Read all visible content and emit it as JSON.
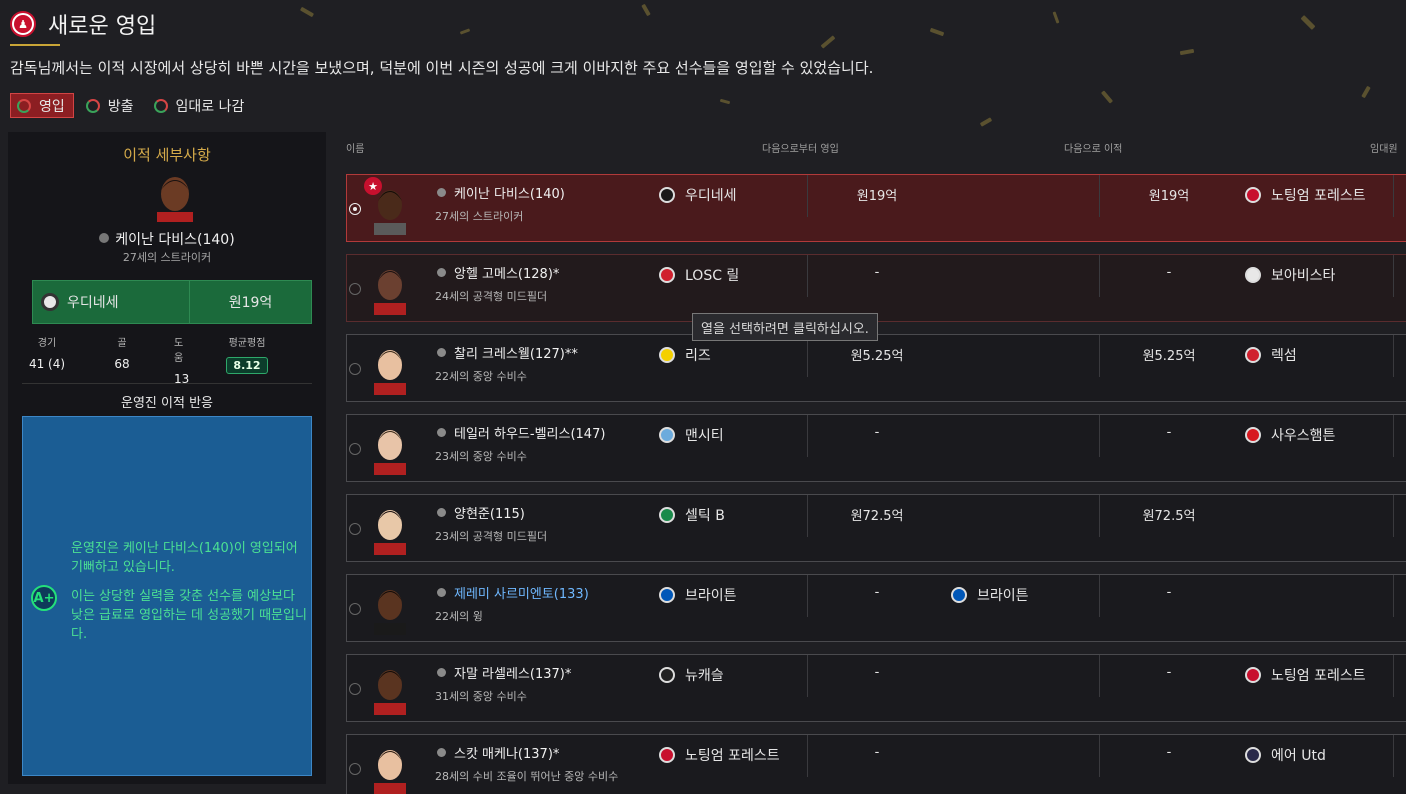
{
  "header": {
    "title": "새로운 영입",
    "subtitle": "감독님께서는 이적 시장에서 상당히 바쁜 시간을 보냈으며, 덕분에 이번 시즌의 성공에 크게 이바지한 주요 선수들을 영입할 수 있었습니다."
  },
  "tabs": [
    {
      "label": "영입",
      "active": true
    },
    {
      "label": "방출",
      "active": false
    },
    {
      "label": "임대로 나감",
      "active": false
    }
  ],
  "details": {
    "title": "이적 세부사항",
    "player_name": "케이난 다비스(140)",
    "player_desc": "27세의 스트라이커",
    "from_club": "우디네세",
    "fee": "원19억",
    "stats": [
      {
        "label": "경기",
        "value": "41 (4)"
      },
      {
        "label": "골",
        "value": "68"
      },
      {
        "label": "도움",
        "value": "13"
      },
      {
        "label": "평균평점",
        "value": "8.12"
      }
    ],
    "reaction_title": "운영진 이적 반응",
    "reaction_grade": "A+",
    "reaction_line1": "운영진은 케이난 다비스(140)이 영입되어 기뻐하고 있습니다.",
    "reaction_line2": "이는 상당한 실력을 갖춘 선수를 예상보다 낮은 급료로 영입하는 데 성공했기 때문입니다."
  },
  "columns": {
    "name": "이름",
    "from": "다음으로부터 영입",
    "to": "다음으로 이적",
    "loan": "임대원"
  },
  "tooltip": "열을 선택하려면 클릭하십시오.",
  "rows": [
    {
      "name": "케이난 다비스(140)",
      "desc": "27세의 스트라이커",
      "from": "우디네세",
      "fee1": "원19억",
      "to": "",
      "fee2": "원19억",
      "next": "노팅엄 포레스트",
      "from_color": "#1a1a1a",
      "next_color": "#c8102e"
    },
    {
      "name": "앙헬 고메스(128)*",
      "desc": "24세의 공격형 미드필더",
      "from": "LOSC 릴",
      "fee1": "-",
      "to": "",
      "fee2": "-",
      "next": "보아비스타",
      "from_color": "#d0202e",
      "next_color": "#e8e8e8"
    },
    {
      "name": "찰리 크레스웰(127)**",
      "desc": "22세의 중앙 수비수",
      "from": "리즈",
      "fee1": "원5.25억",
      "to": "",
      "fee2": "원5.25억",
      "next": "렉섬",
      "from_color": "#f4d000",
      "next_color": "#d0202e"
    },
    {
      "name": "테일러 하우드-벨리스(147)",
      "desc": "23세의 중앙 수비수",
      "from": "맨시티",
      "fee1": "-",
      "to": "",
      "fee2": "-",
      "next": "사우스햄튼",
      "from_color": "#6cabdd",
      "next_color": "#d71920"
    },
    {
      "name": "양현준(115)",
      "desc": "23세의 공격형 미드필더",
      "from": "셀틱 B",
      "fee1": "원72.5억",
      "to": "",
      "fee2": "원72.5억",
      "next": "",
      "from_color": "#1a8a4a",
      "next_color": ""
    },
    {
      "name": "제레미 사르미엔토(133)",
      "desc": "22세의 윙",
      "from": "브라이튼",
      "fee1": "-",
      "to": "브라이튼",
      "fee2": "-",
      "next": "",
      "from_color": "#0057b8",
      "next_color": ""
    },
    {
      "name": "자말 라셀레스(137)*",
      "desc": "31세의 중앙 수비수",
      "from": "뉴캐슬",
      "fee1": "-",
      "to": "",
      "fee2": "-",
      "next": "노팅엄 포레스트",
      "from_color": "#222222",
      "next_color": "#c8102e"
    },
    {
      "name": "스캇 매케나(137)*",
      "desc": "28세의 수비 조율이 뛰어난 중앙 수비수",
      "from": "노팅엄 포레스트",
      "fee1": "-",
      "to": "",
      "fee2": "-",
      "next": "에어 Utd",
      "from_color": "#c8102e",
      "next_color": "#2a2a4a"
    }
  ]
}
